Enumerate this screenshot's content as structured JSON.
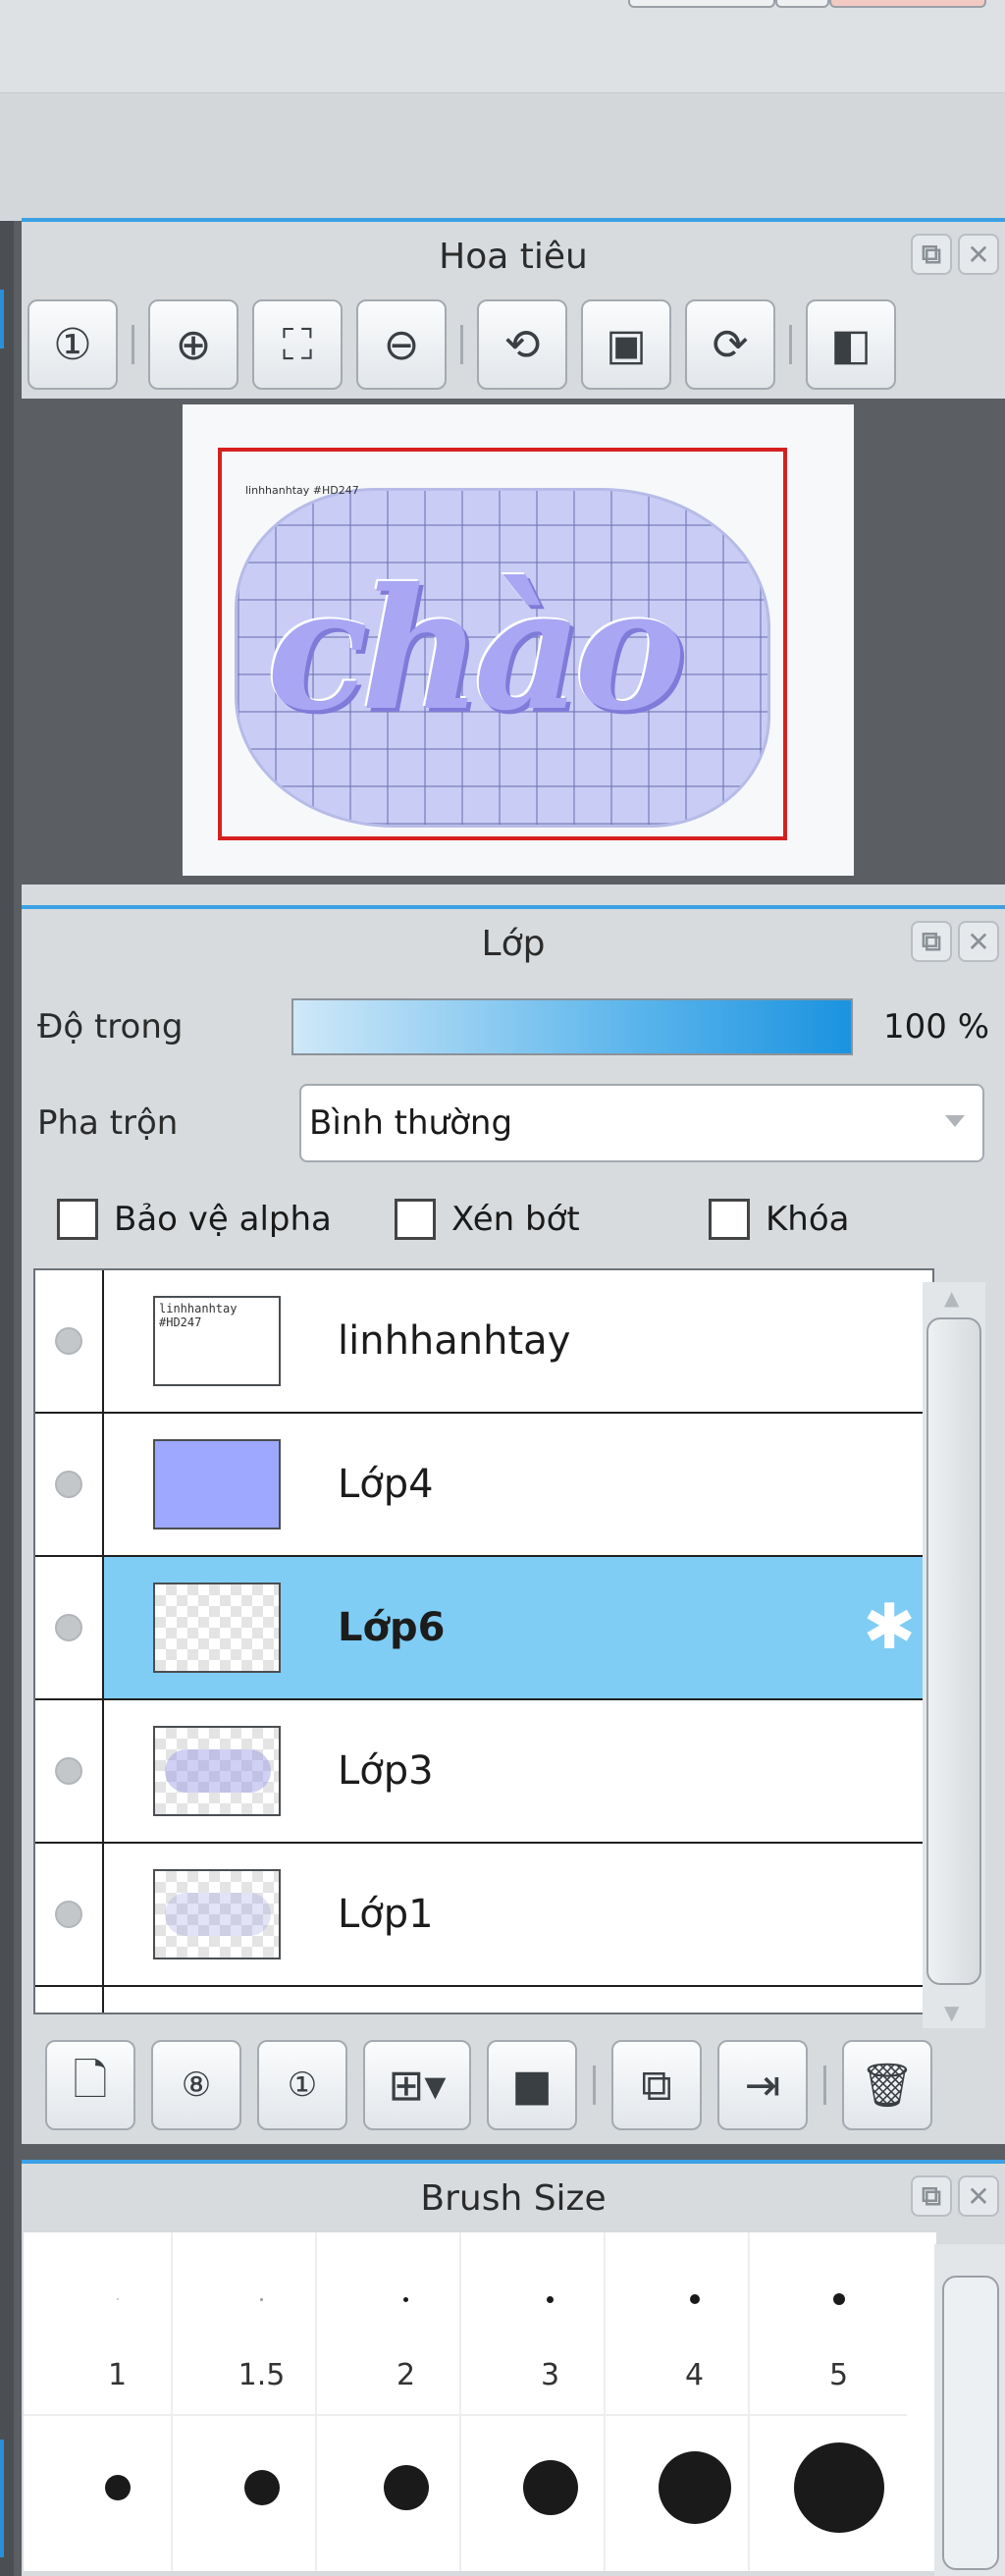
{
  "navigator": {
    "title": "Hoa tiêu",
    "toolbar_icons": [
      "zoom-actual-icon",
      "zoom-in-icon",
      "fit-screen-icon",
      "zoom-out-icon",
      "rotate-left-icon",
      "fit-canvas-icon",
      "rotate-right-icon",
      "flip-horizontal-icon"
    ],
    "preview_text": "chào",
    "preview_watermark": "linhhanhtay #HD247"
  },
  "layers": {
    "title": "Lớp",
    "opacity_label": "Độ trong",
    "opacity_value": "100 %",
    "opacity_level": 1.0,
    "blend_label": "Pha trộn",
    "blend_value": "Bình thường",
    "checks": {
      "protect_alpha": "Bảo vệ alpha",
      "clipping": "Xén bớt",
      "lock": "Khóa"
    },
    "items": [
      {
        "name": "linhhanhtay",
        "thumb": "text",
        "thumb_text": "linhhanhtay #HD247",
        "selected": false
      },
      {
        "name": "Lớp4",
        "thumb": "solid",
        "selected": false
      },
      {
        "name": "Lớp6",
        "thumb": "transparent",
        "selected": true
      },
      {
        "name": "Lớp3",
        "thumb": "cloud",
        "selected": false
      },
      {
        "name": "Lớp1",
        "thumb": "cloud",
        "selected": false
      }
    ],
    "toolbar_icons": [
      "new-layer-icon",
      "new-8bit-layer-icon",
      "new-1bit-layer-icon",
      "add-layer-dropdown-icon",
      "folder-icon",
      "duplicate-layer-icon",
      "merge-down-icon",
      "trash-icon"
    ]
  },
  "brush_size": {
    "title": "Brush Size",
    "row1": [
      "1",
      "1.5",
      "2",
      "3",
      "4",
      "5"
    ]
  },
  "colors": {
    "accent": "#3aa0e6",
    "selected_row": "#7fcdf4",
    "frame_red": "#d62020"
  }
}
